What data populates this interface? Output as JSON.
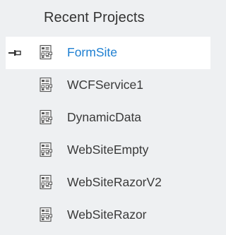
{
  "panel": {
    "title": "Recent Projects"
  },
  "projects": [
    {
      "name": "FormSite",
      "pinned": true,
      "selected": true,
      "icon": "website-project-icon"
    },
    {
      "name": "WCFService1",
      "pinned": false,
      "selected": false,
      "icon": "website-project-icon"
    },
    {
      "name": "DynamicData",
      "pinned": false,
      "selected": false,
      "icon": "website-project-icon"
    },
    {
      "name": "WebSiteEmpty",
      "pinned": false,
      "selected": false,
      "icon": "website-project-icon"
    },
    {
      "name": "WebSiteRazorV2",
      "pinned": false,
      "selected": false,
      "icon": "website-project-icon"
    },
    {
      "name": "WebSiteRazor",
      "pinned": false,
      "selected": false,
      "icon": "website-project-icon"
    }
  ],
  "colors": {
    "background": "#eef0f2",
    "selected_background": "#ffffff",
    "selected_text": "#1e7fd1",
    "text": "#3a3a3a"
  }
}
